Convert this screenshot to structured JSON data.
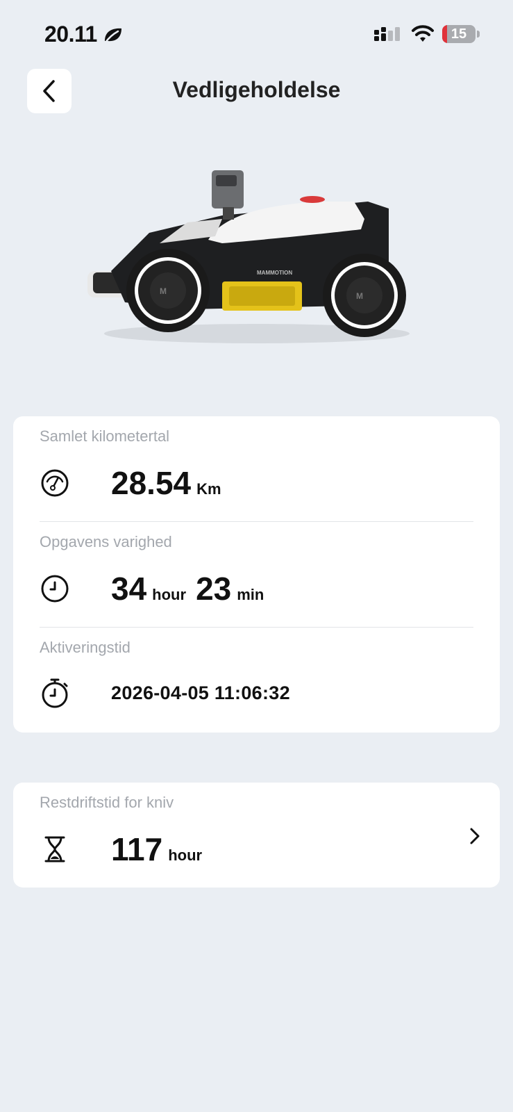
{
  "status_bar": {
    "time": "20.11",
    "battery_percent": 15,
    "battery_label": "15",
    "colors": {
      "battery_low": "#e0323a"
    }
  },
  "header": {
    "title": "Vedligeholdelse",
    "back_icon": "chevron-left-icon"
  },
  "product_image": {
    "brand_text": "MAMMOTION"
  },
  "stats": {
    "odometer": {
      "label": "Samlet kilometertal",
      "value": "28.54",
      "unit": "Km",
      "icon": "speedometer-icon"
    },
    "duration": {
      "label": "Opgavens varighed",
      "hours": "34",
      "hours_unit": "hour",
      "minutes": "23",
      "minutes_unit": "min",
      "icon": "clock-icon"
    },
    "activation": {
      "label": "Aktiveringstid",
      "value": "2026-04-05 11:06:32",
      "icon": "stopwatch-icon"
    }
  },
  "blade": {
    "label": "Restdriftstid for kniv",
    "value": "117",
    "unit": "hour",
    "icon": "hourglass-icon"
  }
}
